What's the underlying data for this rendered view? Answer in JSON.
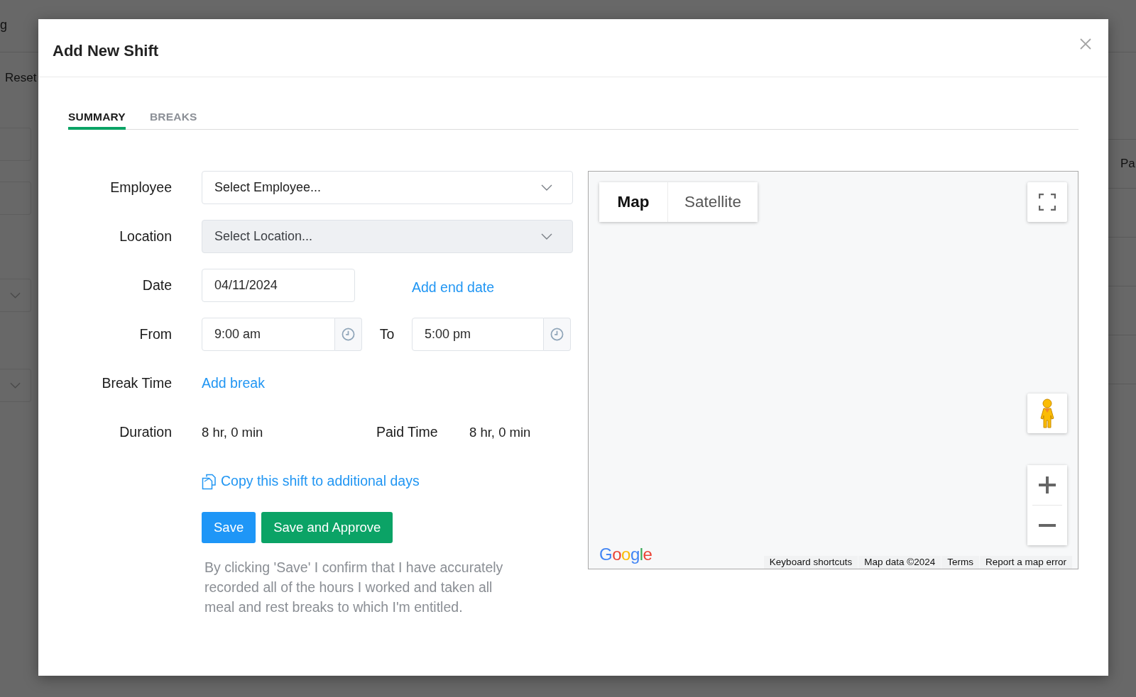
{
  "background": {
    "nav_fragment": "g",
    "reset_button": "Reset",
    "column_header": "Pa"
  },
  "dialog": {
    "title": "Add New Shift",
    "tabs": [
      {
        "label": "SUMMARY",
        "selected": true
      },
      {
        "label": "BREAKS",
        "selected": false
      }
    ],
    "form": {
      "employee": {
        "label": "Employee",
        "placeholder": "Select Employee...",
        "disabled": false
      },
      "location": {
        "label": "Location",
        "placeholder": "Select Location...",
        "disabled": true
      },
      "date": {
        "label": "Date",
        "value": "04/11/2024",
        "link": "Add end date"
      },
      "from": {
        "label": "From",
        "value": "9:00 am"
      },
      "to": {
        "label": "To",
        "value": "5:00 pm"
      },
      "break_time": {
        "label": "Break Time",
        "link": "Add break"
      },
      "duration": {
        "label": "Duration",
        "value": "8 hr, 0 min"
      },
      "paid_time": {
        "label": "Paid Time",
        "value": "8 hr, 0 min"
      },
      "copy_link": "Copy this shift to additional days"
    },
    "buttons": [
      {
        "label": "Save",
        "kind": "primary"
      },
      {
        "label": "Save and Approve",
        "kind": "approve"
      }
    ],
    "disclaimer": "By clicking 'Save' I confirm that I have accurately recorded all of the hours I worked and taken all meal and rest breaks to which I'm entitled."
  },
  "map": {
    "map_types": [
      {
        "label": "Map",
        "selected": true
      },
      {
        "label": "Satellite",
        "selected": false
      }
    ],
    "logo": "Google",
    "attribution": [
      "Keyboard shortcuts",
      "Map data ©2024",
      "Terms",
      "Report a map error"
    ]
  }
}
